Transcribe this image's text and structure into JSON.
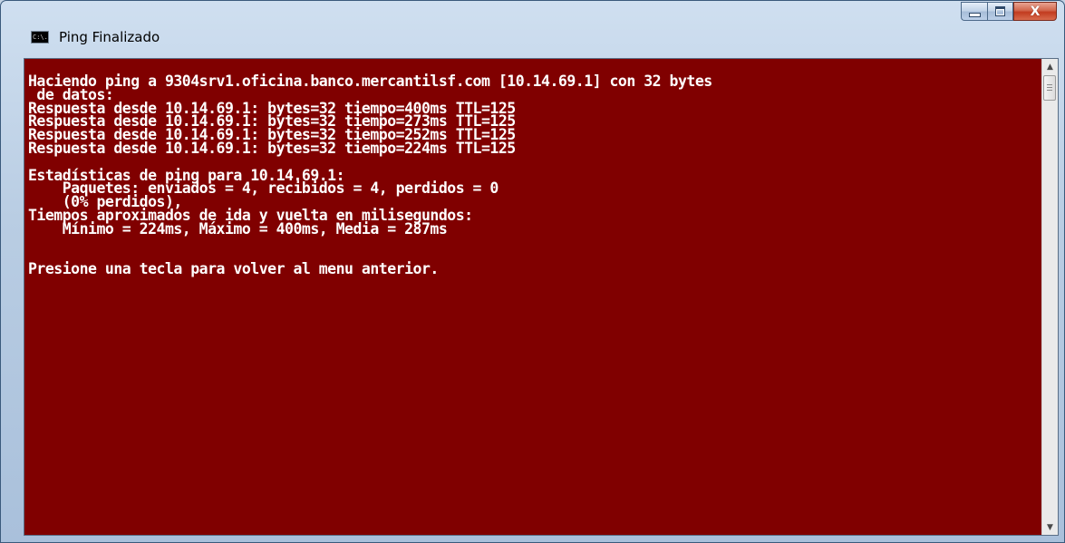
{
  "window": {
    "title": "Ping Finalizado",
    "icon_name": "cmd-console-icon",
    "icon_glyph": "C:\\.",
    "buttons": {
      "minimize_icon": "minimize-icon",
      "maximize_icon": "maximize-icon",
      "close_icon": "close-icon",
      "close_glyph": "X"
    }
  },
  "console": {
    "background_color": "#800000",
    "text_color": "#ffffff",
    "lines": [
      "Haciendo ping a 9304srv1.oficina.banco.mercantilsf.com [10.14.69.1] con 32 bytes",
      " de datos:",
      "Respuesta desde 10.14.69.1: bytes=32 tiempo=400ms TTL=125",
      "Respuesta desde 10.14.69.1: bytes=32 tiempo=273ms TTL=125",
      "Respuesta desde 10.14.69.1: bytes=32 tiempo=252ms TTL=125",
      "Respuesta desde 10.14.69.1: bytes=32 tiempo=224ms TTL=125",
      "",
      "Estadísticas de ping para 10.14.69.1:",
      "    Paquetes: enviados = 4, recibidos = 4, perdidos = 0",
      "    (0% perdidos),",
      "Tiempos aproximados de ida y vuelta en milisegundos:",
      "    Mínimo = 224ms, Máximo = 400ms, Media = 287ms",
      "",
      "",
      "Presione una tecla para volver al menu anterior."
    ]
  },
  "scrollbar": {
    "up_icon": "scroll-up-arrow-icon",
    "down_icon": "scroll-down-arrow-icon",
    "up_glyph": "▲",
    "down_glyph": "▼"
  }
}
